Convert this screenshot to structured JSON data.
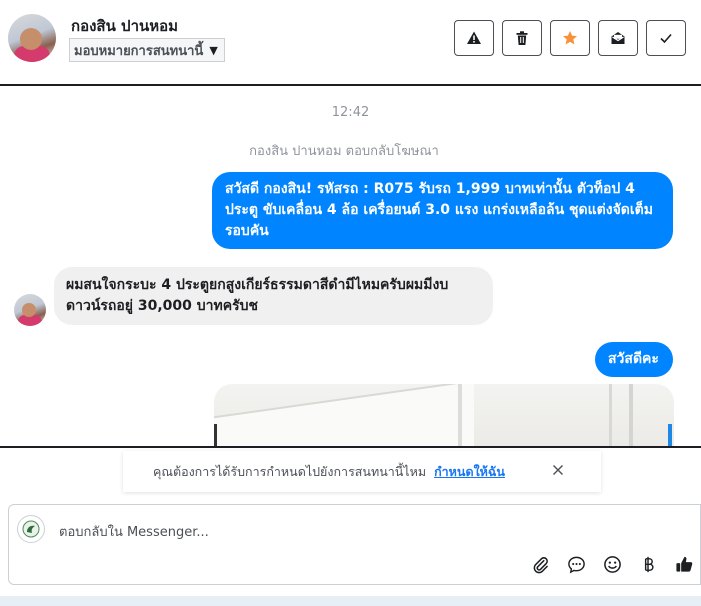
{
  "header": {
    "contact_name": "กองสิน ปานหอม",
    "assign_label": "มอบหมายการสนทนานี้",
    "actions": [
      {
        "name": "report-spam-button",
        "icon": "warning-icon"
      },
      {
        "name": "delete-button",
        "icon": "trash-icon"
      },
      {
        "name": "star-button",
        "icon": "star-icon",
        "color": "#f7923a"
      },
      {
        "name": "mark-unread-button",
        "icon": "open-envelope-icon"
      },
      {
        "name": "mark-done-button",
        "icon": "checkmark-icon"
      }
    ]
  },
  "conversation": {
    "timestamp": "12:42",
    "system_line": "กองสิน ปานหอม ตอบกลับโฆษณา",
    "messages": [
      {
        "from": "page",
        "text": "สวัสดี กองสิน! รหัสรถ : R075 รับรถ 1,999 บาทเท่านั้น ตัวท็อป 4 ประตู ขับเคลื่อน 4 ล้อ  เครื่อยนต์ 3.0 แรง แกร่งเหลือล้น ชุดแต่งจัดเต็มรอบคัน"
      },
      {
        "from": "customer",
        "text": "ผมสนใจกระบะ 4 ประตูยกสูงเกียร์ธรรมดาสีดำมีไหมครับผมมีงบดาวน์รถอยู่ 30,000 บาทครับช"
      },
      {
        "from": "page",
        "text": "สวัสดีคะ"
      }
    ]
  },
  "banner": {
    "text": "คุณต้องการได้รับการกำหนดไปยังการสนทนานี้ไหม",
    "link": "กำหนดให้ฉัน"
  },
  "composer": {
    "placeholder": "ตอบกลับใน Messenger...",
    "tools": [
      "attachment-icon",
      "saved-reply-icon",
      "emoji-icon",
      "baht-icon",
      "thumbs-up-icon"
    ]
  },
  "colors": {
    "accent": "#0084ff",
    "link": "#1876f2",
    "star": "#f7923a"
  }
}
